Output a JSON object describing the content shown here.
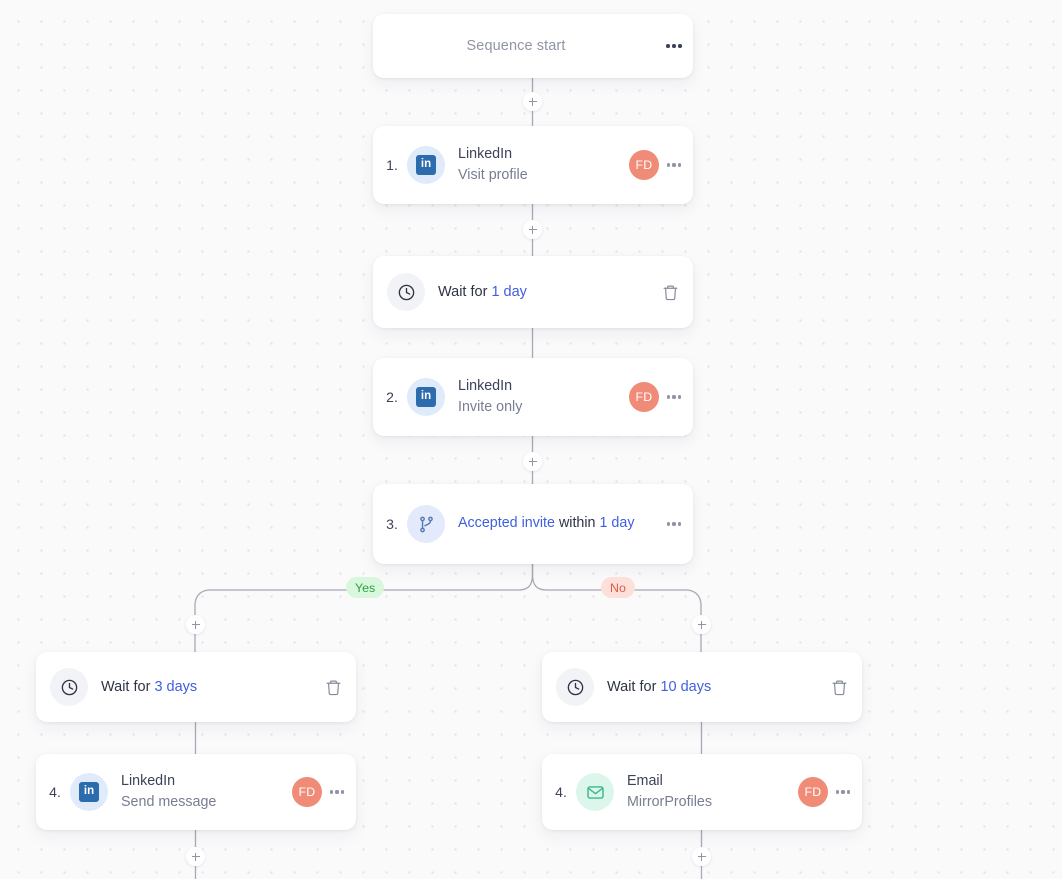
{
  "theme": {
    "canvas_bg": "#fafafb",
    "dot_color": "#e2e3e8",
    "card_bg": "#ffffff",
    "accent_blue": "#3f5fe0",
    "avatar_color": "#ef8b77",
    "yes_color": "#2f9e46",
    "no_color": "#e05b44",
    "connector_color": "#a7a9b4"
  },
  "sequence": {
    "start": {
      "label": "Sequence start",
      "menu_icon": "ellipsis-icon"
    },
    "nodes": [
      {
        "id": "step-1",
        "type": "action",
        "index": "1.",
        "icon": "linkedin-icon",
        "icon_text": "in",
        "title": "LinkedIn",
        "subtitle": "Visit profile",
        "avatar": "FD",
        "menu_icon": "ellipsis-icon"
      },
      {
        "id": "wait-1",
        "type": "wait",
        "icon": "clock-icon",
        "prefix": "Wait for",
        "duration": "1 day",
        "delete_icon": "trash-icon"
      },
      {
        "id": "step-2",
        "type": "action",
        "index": "2.",
        "icon": "linkedin-icon",
        "icon_text": "in",
        "title": "LinkedIn",
        "subtitle": "Invite only",
        "avatar": "FD",
        "menu_icon": "ellipsis-icon"
      },
      {
        "id": "step-3",
        "type": "condition",
        "index": "3.",
        "icon": "branch-icon",
        "condition": "Accepted invite",
        "middle": "within",
        "duration": "1 day",
        "menu_icon": "ellipsis-icon"
      }
    ],
    "branches": {
      "yes_label": "Yes",
      "no_label": "No",
      "yes": [
        {
          "id": "wait-yes",
          "type": "wait",
          "icon": "clock-icon",
          "prefix": "Wait for",
          "duration": "3 days",
          "delete_icon": "trash-icon"
        },
        {
          "id": "step-4-yes",
          "type": "action",
          "index": "4.",
          "icon": "linkedin-icon",
          "icon_text": "in",
          "title": "LinkedIn",
          "subtitle": "Send message",
          "avatar": "FD",
          "menu_icon": "ellipsis-icon"
        }
      ],
      "no": [
        {
          "id": "wait-no",
          "type": "wait",
          "icon": "clock-icon",
          "prefix": "Wait for",
          "duration": "10 days",
          "delete_icon": "trash-icon"
        },
        {
          "id": "step-4-no",
          "type": "action",
          "index": "4.",
          "icon": "email-icon",
          "title": "Email",
          "subtitle": "MirrorProfiles",
          "avatar": "FD",
          "menu_icon": "ellipsis-icon"
        }
      ]
    },
    "add_button_label": "+"
  }
}
